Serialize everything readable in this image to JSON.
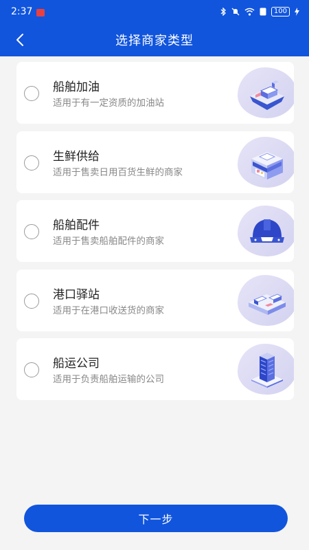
{
  "status_bar": {
    "time": "2:37",
    "battery": "100"
  },
  "header": {
    "title": "选择商家类型",
    "back_icon": "chevron-left-icon"
  },
  "options": [
    {
      "title": "船舶加油",
      "description": "适用于有一定资质的加油站",
      "icon": "ship-icon",
      "selected": false
    },
    {
      "title": "生鲜供给",
      "description": "适用于售卖日用百货生鲜的商家",
      "icon": "store-icon",
      "selected": false
    },
    {
      "title": "船舶配件",
      "description": "适用于售卖船舶配件的商家",
      "icon": "helmet-icon",
      "selected": false
    },
    {
      "title": "港口驿站",
      "description": "适用于在港口收送货的商家",
      "icon": "port-icon",
      "selected": false
    },
    {
      "title": "船运公司",
      "description": "适用于负责船舶运输的公司",
      "icon": "building-icon",
      "selected": false
    }
  ],
  "footer": {
    "next_label": "下一步"
  },
  "colors": {
    "primary": "#1155dd",
    "background": "#f4f4f4"
  }
}
